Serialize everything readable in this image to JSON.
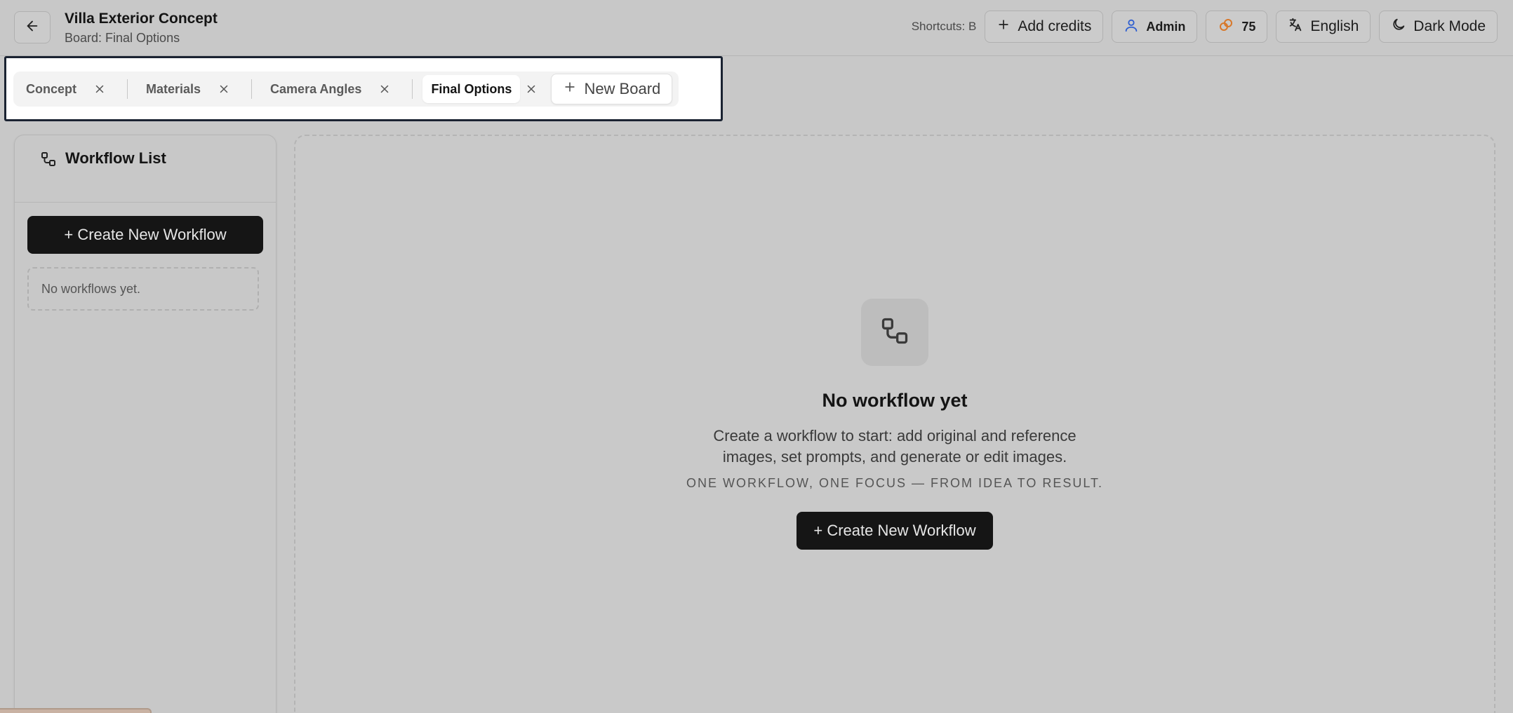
{
  "header": {
    "title": "Villa Exterior Concept",
    "subtitle": "Board: Final Options",
    "shortcuts": "Shortcuts: B",
    "add_credits": "Add credits",
    "user": "Admin",
    "credits": "75",
    "language": "English",
    "theme": "Dark Mode"
  },
  "tabs": [
    {
      "label": "Concept",
      "active": false
    },
    {
      "label": "Materials",
      "active": false
    },
    {
      "label": "Camera Angles",
      "active": false
    },
    {
      "label": "Final Options",
      "active": true
    }
  ],
  "new_board": "New Board",
  "workflow_list": {
    "title": "Workflow List",
    "create_label": "+ Create New Workflow",
    "empty_text": "No workflows yet."
  },
  "empty_state": {
    "title": "No workflow yet",
    "description": "Create a workflow to start: add original and reference images, set prompts, and generate or edit images.",
    "tagline": "ONE WORKFLOW, ONE FOCUS — FROM IDEA TO RESULT.",
    "create_label": "+ Create New Workflow"
  },
  "icons": {
    "back": "arrow-left-icon",
    "add": "plus-icon",
    "user": "user-icon",
    "credits": "coins-icon",
    "language": "translate-icon",
    "theme": "moon-icon",
    "close": "close-icon",
    "workflow": "workflow-icon"
  },
  "colors": {
    "primary_button": "#151515",
    "user_icon": "#2f5fd0",
    "credits_icon": "#d8782a",
    "focus_outline": "#1b2332"
  }
}
